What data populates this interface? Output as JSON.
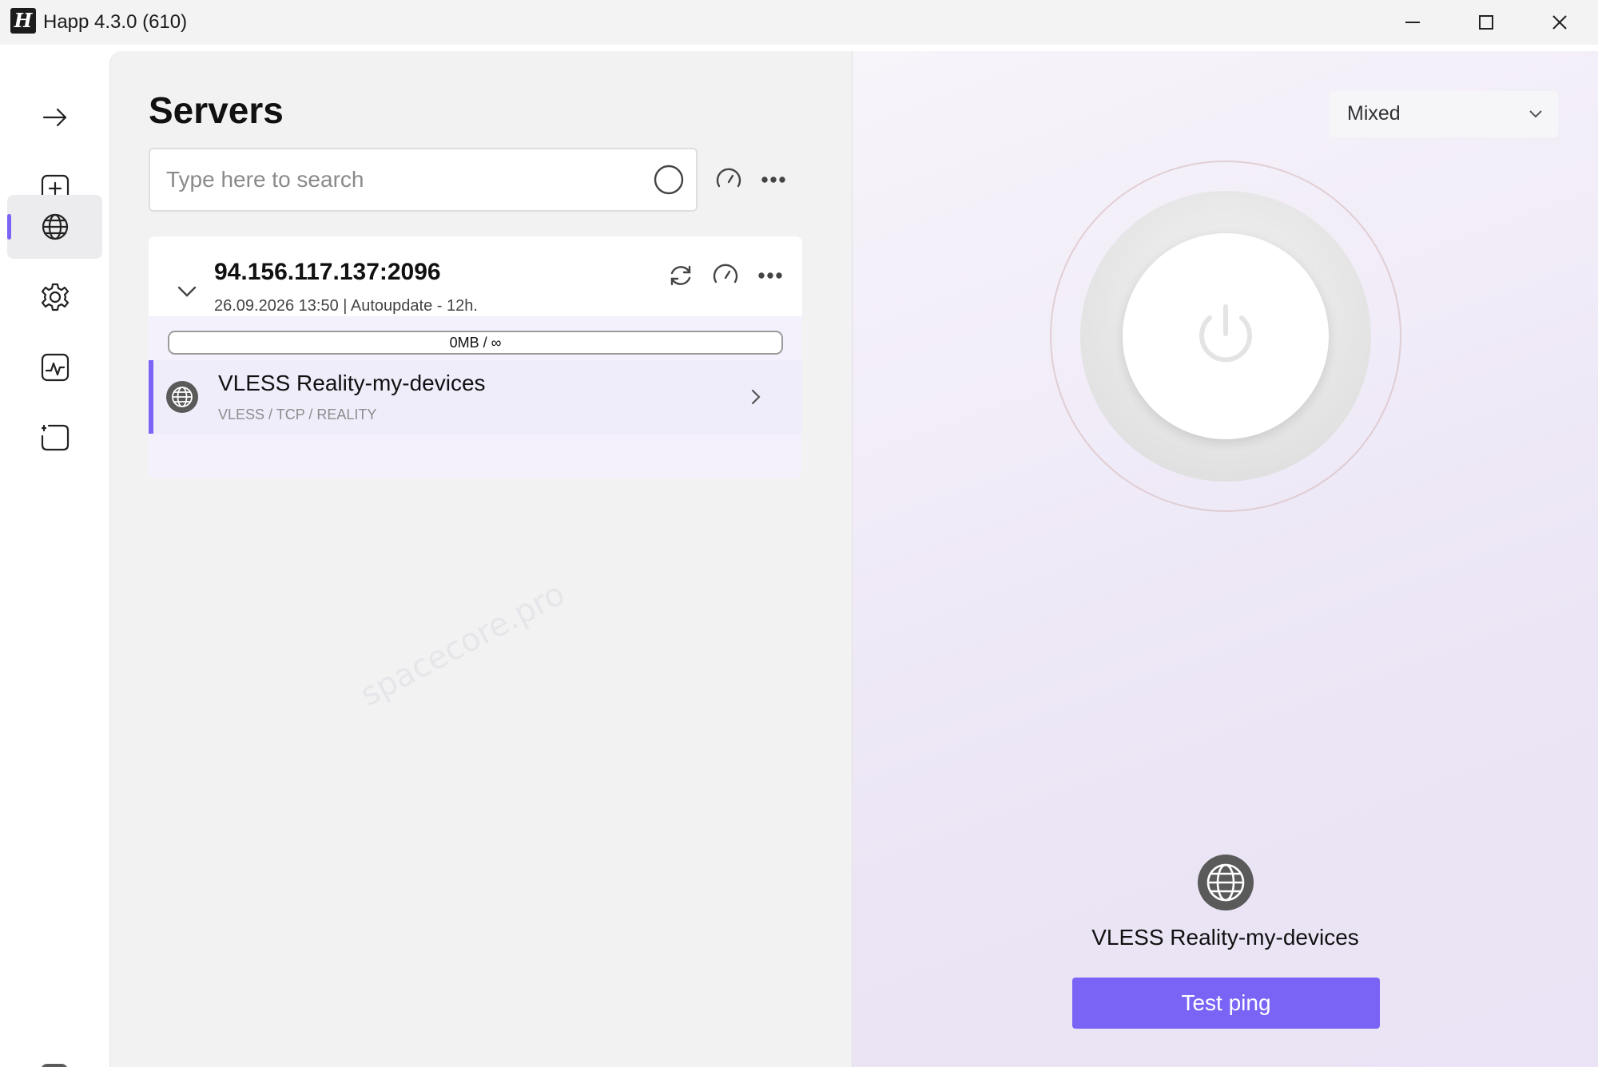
{
  "window": {
    "title": "Happ 4.3.0 (610)",
    "logo_letter": "H"
  },
  "sidebar": {
    "items": [
      {
        "name": "connect",
        "icon": "arrow-right-icon"
      },
      {
        "name": "add",
        "icon": "add-square-icon"
      },
      {
        "name": "servers",
        "icon": "globe-icon",
        "active": true
      },
      {
        "name": "settings",
        "icon": "gear-icon"
      },
      {
        "name": "stats",
        "icon": "activity-icon"
      },
      {
        "name": "screen",
        "icon": "screen-capture-icon"
      }
    ],
    "info_label": "i"
  },
  "servers": {
    "title": "Servers",
    "search_placeholder": "Type here to search",
    "group": {
      "address": "94.156.117.137:2096",
      "subtitle": "26.09.2026 13:50 | Autoupdate - 12h.",
      "traffic": "0MB / ∞",
      "servers": [
        {
          "name": "VLESS Reality-my-devices",
          "protocol": "VLESS / TCP / REALITY"
        }
      ]
    }
  },
  "connection": {
    "mode": "Mixed",
    "selected_server": "VLESS Reality-my-devices",
    "test_ping_label": "Test ping"
  },
  "colors": {
    "accent": "#7a64f5"
  },
  "watermark": "spacecore.pro"
}
